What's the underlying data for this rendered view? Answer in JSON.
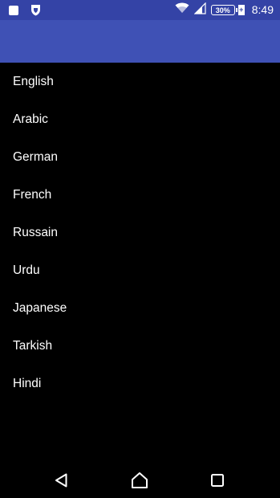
{
  "status_bar": {
    "time": "8:49",
    "battery_percent": "30%",
    "icons": [
      "notification-square-icon",
      "shield-icon",
      "wifi-icon",
      "cellular-signal-icon",
      "battery-charging-icon"
    ]
  },
  "app_bar": {
    "title": "",
    "color": "#3f51b5"
  },
  "languages": [
    "English",
    "Arabic",
    "German",
    "French",
    "Russain",
    "Urdu",
    "Japanese",
    "Tarkish",
    "Hindi"
  ],
  "nav_bar": {
    "buttons": [
      "back-icon",
      "home-icon",
      "recents-icon"
    ]
  },
  "colors": {
    "status_bar": "#3443a6",
    "app_bar": "#3f51b5",
    "background": "#000000",
    "text": "#ffffff"
  }
}
